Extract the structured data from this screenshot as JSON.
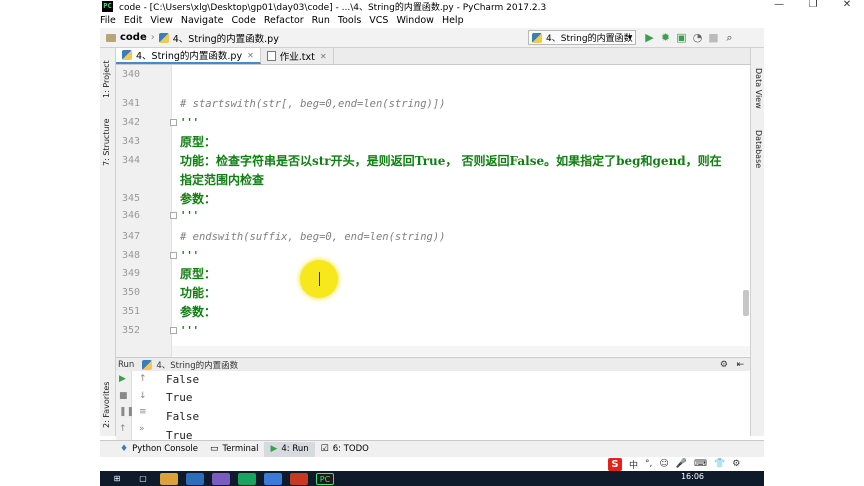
{
  "window": {
    "title": "code - [C:\\Users\\xlg\\Desktop\\gp01\\day03\\code] - ...\\4、String的内置函数.py - PyCharm 2017.2.3",
    "app_icon": "PC",
    "controls": [
      "—",
      "❐",
      "✕"
    ]
  },
  "menu": [
    "File",
    "Edit",
    "View",
    "Navigate",
    "Code",
    "Refactor",
    "Run",
    "Tools",
    "VCS",
    "Window",
    "Help"
  ],
  "toolbar": {
    "project": "code",
    "file": "4、String的内置函数.py",
    "run_config": "4、String的内置函数",
    "icons": [
      "run-icon",
      "debug-icon",
      "coverage-icon",
      "profile-icon",
      "stop-icon",
      "search-icon"
    ]
  },
  "left_tabs": [
    "1: Project",
    "7: Structure",
    "2: Favorites"
  ],
  "right_tabs": [
    "Data View",
    "Database"
  ],
  "editor_tabs": [
    {
      "label": "4、String的内置函数.py",
      "active": true
    },
    {
      "label": "作业.txt",
      "active": false
    }
  ],
  "editor": {
    "lines": [
      {
        "num": "340",
        "text": "",
        "kind": "plain"
      },
      {
        "num": "341",
        "text": "# startswith(str[, beg=0,end=len(string)])",
        "kind": "comment"
      },
      {
        "num": "342",
        "text": "'''",
        "kind": "str"
      },
      {
        "num": "343",
        "text": "原型：",
        "kind": "cjk"
      },
      {
        "num": "344",
        "text": "功能：检查字符串是否以str开头，是则返回True， 否则返回False。如果指定了beg和gend，则在",
        "kind": "cjk"
      },
      {
        "num": "",
        "text": "指定范围内检查",
        "kind": "cjk"
      },
      {
        "num": "345",
        "text": "参数：",
        "kind": "cjk"
      },
      {
        "num": "346",
        "text": "'''",
        "kind": "str"
      },
      {
        "num": "347",
        "text": "# endswith(suffix, beg=0, end=len(string))",
        "kind": "comment"
      },
      {
        "num": "348",
        "text": "'''",
        "kind": "str"
      },
      {
        "num": "349",
        "text": "原型：",
        "kind": "cjk"
      },
      {
        "num": "350",
        "text": "功能：",
        "kind": "cjk"
      },
      {
        "num": "351",
        "text": "参数：",
        "kind": "cjk"
      },
      {
        "num": "352",
        "text": "'''",
        "kind": "str"
      }
    ]
  },
  "run_panel": {
    "label": "Run",
    "file": "4、String的内置函数",
    "output": [
      "False",
      "True",
      "False",
      "True"
    ]
  },
  "bottom_tabs": [
    {
      "label": "Python Console",
      "icon": "python-console-icon",
      "active": false
    },
    {
      "label": "Terminal",
      "icon": "terminal-icon",
      "active": false
    },
    {
      "label": "4: Run",
      "icon": "run-icon",
      "active": true
    },
    {
      "label": "6: TODO",
      "icon": "todo-icon",
      "active": false
    }
  ],
  "ime": {
    "logo": "S",
    "items": [
      "中",
      "°,",
      "☺",
      "🎤",
      "⌨",
      "👕",
      "⚙"
    ]
  },
  "clock": "16:06"
}
